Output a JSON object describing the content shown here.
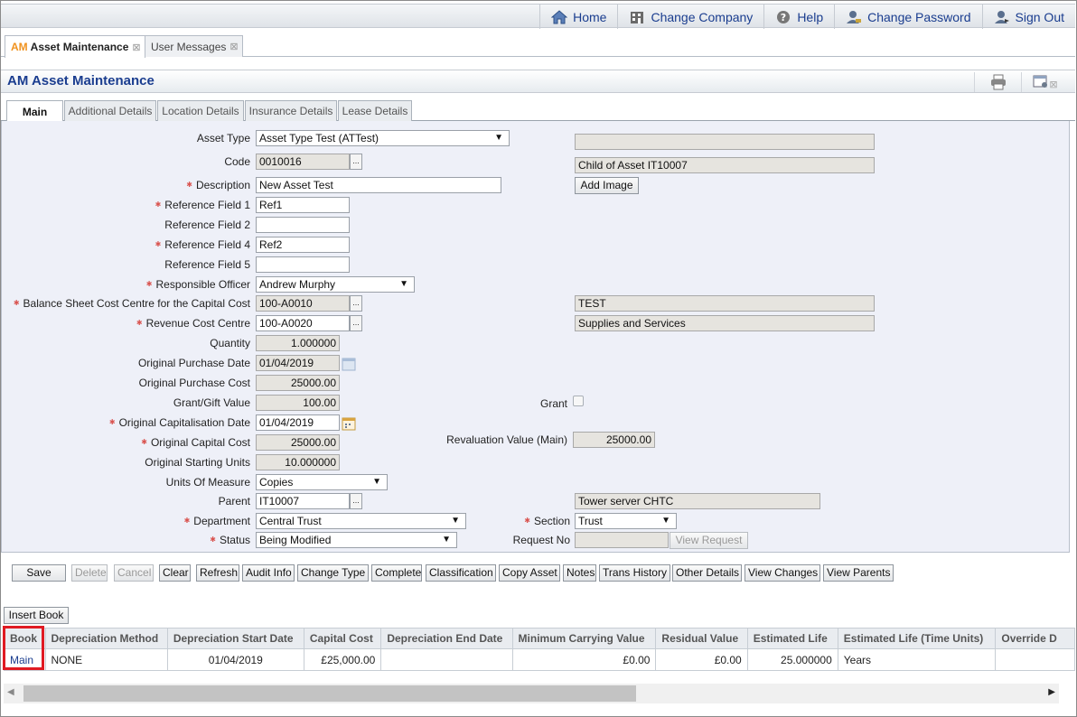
{
  "nav": {
    "home": "Home",
    "change_company": "Change Company",
    "help": "Help",
    "change_password": "Change Password",
    "sign_out": "Sign Out"
  },
  "tabs": [
    {
      "prefix": "AM",
      "label": "Asset Maintenance",
      "active": true
    },
    {
      "prefix": "",
      "label": "User Messages",
      "active": false
    }
  ],
  "page_title": "AM Asset Maintenance",
  "subtabs": [
    "Main",
    "Additional Details",
    "Location Details",
    "Insurance Details",
    "Lease Details"
  ],
  "form": {
    "asset_type": {
      "label": "Asset Type",
      "value": "Asset Type Test (ATTest)"
    },
    "code": {
      "label": "Code",
      "value": "0010016"
    },
    "description": {
      "label": "Description",
      "value": "New Asset Test"
    },
    "ref1": {
      "label": "Reference Field 1",
      "value": "Ref1"
    },
    "ref2": {
      "label": "Reference Field 2",
      "value": ""
    },
    "ref4": {
      "label": "Reference Field 4",
      "value": "Ref2"
    },
    "ref5": {
      "label": "Reference Field 5",
      "value": ""
    },
    "responsible_officer": {
      "label": "Responsible Officer",
      "value": "Andrew Murphy"
    },
    "balance_sheet_cc": {
      "label": "Balance Sheet Cost Centre for the Capital Cost",
      "value": "100-A0010",
      "desc": "TEST"
    },
    "revenue_cc": {
      "label": "Revenue Cost Centre",
      "value": "100-A0020",
      "desc": "Supplies and Services"
    },
    "quantity": {
      "label": "Quantity",
      "value": "1.000000"
    },
    "orig_purchase_date": {
      "label": "Original Purchase Date",
      "value": "01/04/2019"
    },
    "orig_purchase_cost": {
      "label": "Original Purchase Cost",
      "value": "25000.00"
    },
    "grant_gift_value": {
      "label": "Grant/Gift Value",
      "value": "100.00"
    },
    "grant": {
      "label": "Grant"
    },
    "orig_cap_date": {
      "label": "Original Capitalisation Date",
      "value": "01/04/2019"
    },
    "orig_capital_cost": {
      "label": "Original Capital Cost",
      "value": "25000.00"
    },
    "revaluation_value": {
      "label": "Revaluation Value (Main)",
      "value": "25000.00"
    },
    "orig_starting_units": {
      "label": "Original Starting Units",
      "value": "10.000000"
    },
    "units_of_measure": {
      "label": "Units Of Measure",
      "value": "Copies"
    },
    "parent": {
      "label": "Parent",
      "value": "IT10007",
      "desc": "Tower server CHTC"
    },
    "department": {
      "label": "Department",
      "value": "Central Trust"
    },
    "section": {
      "label": "Section",
      "value": "Trust"
    },
    "status": {
      "label": "Status",
      "value": "Being Modified"
    },
    "request_no": {
      "label": "Request No",
      "value": ""
    },
    "view_request": "View Request",
    "right_top": "",
    "child_of": "Child of Asset IT10007",
    "add_image": "Add Image",
    "lookup": "..."
  },
  "buttons": [
    "Save",
    "Delete",
    "Cancel",
    "Clear",
    "Refresh",
    "Audit Info",
    "Change Type",
    "Complete",
    "Classification",
    "Copy Asset",
    "Notes",
    "Trans History",
    "Other Details",
    "View Changes",
    "View Parents"
  ],
  "insert_book": "Insert Book",
  "grid": {
    "headers": [
      "Book",
      "Depreciation Method",
      "Depreciation Start Date",
      "Capital Cost",
      "Depreciation End Date",
      "Minimum Carrying Value",
      "Residual Value",
      "Estimated Life",
      "Estimated Life (Time Units)",
      "Override D"
    ],
    "rows": [
      [
        "Main",
        "NONE",
        "01/04/2019",
        "£25,000.00",
        "",
        "£0.00",
        "£0.00",
        "25.000000",
        "Years",
        ""
      ]
    ]
  },
  "colors": {
    "link": "#1a3d8f",
    "accent": "#f0921e",
    "required": "#d9534f",
    "highlight": "#e01a22",
    "panel": "#eef0f8"
  }
}
